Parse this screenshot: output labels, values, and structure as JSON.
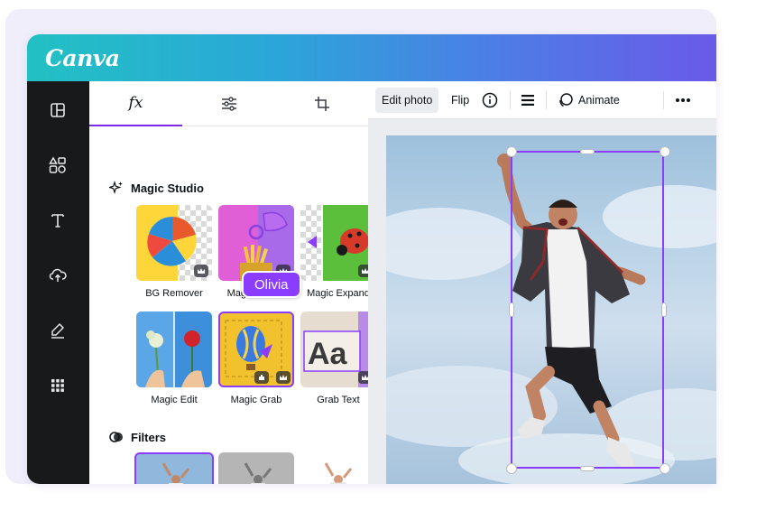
{
  "app": {
    "logo": "Canva"
  },
  "rail": {
    "items": [
      {
        "icon": "layout-icon"
      },
      {
        "icon": "elements-icon"
      },
      {
        "icon": "text-icon"
      },
      {
        "icon": "upload-cloud-icon"
      },
      {
        "icon": "draw-icon"
      },
      {
        "icon": "apps-grid-icon"
      }
    ]
  },
  "panel": {
    "tabs": [
      {
        "label": "fx",
        "active": true
      },
      {
        "icon": "adjust-sliders-icon"
      },
      {
        "icon": "crop-icon"
      }
    ],
    "magic_studio": {
      "title": "Magic Studio",
      "tools": [
        {
          "label": "BG Remover",
          "premium": true
        },
        {
          "label": "Magic Eraser",
          "premium": true
        },
        {
          "label": "Magic Expand",
          "premium": true
        },
        {
          "label": "Magic Edit",
          "premium": false
        },
        {
          "label": "Magic Grab",
          "premium": true
        },
        {
          "label": "Grab Text",
          "premium": true
        }
      ]
    },
    "filters": {
      "title": "Filters"
    }
  },
  "toolbar": {
    "edit_photo": "Edit photo",
    "flip": "Flip",
    "animate": "Animate"
  },
  "collaborator": {
    "name": "Olivia"
  },
  "colors": {
    "accent": "#8b3dff",
    "rail": "#18191b",
    "gradient_start": "#22c1c3",
    "gradient_end": "#6a5ae8"
  }
}
